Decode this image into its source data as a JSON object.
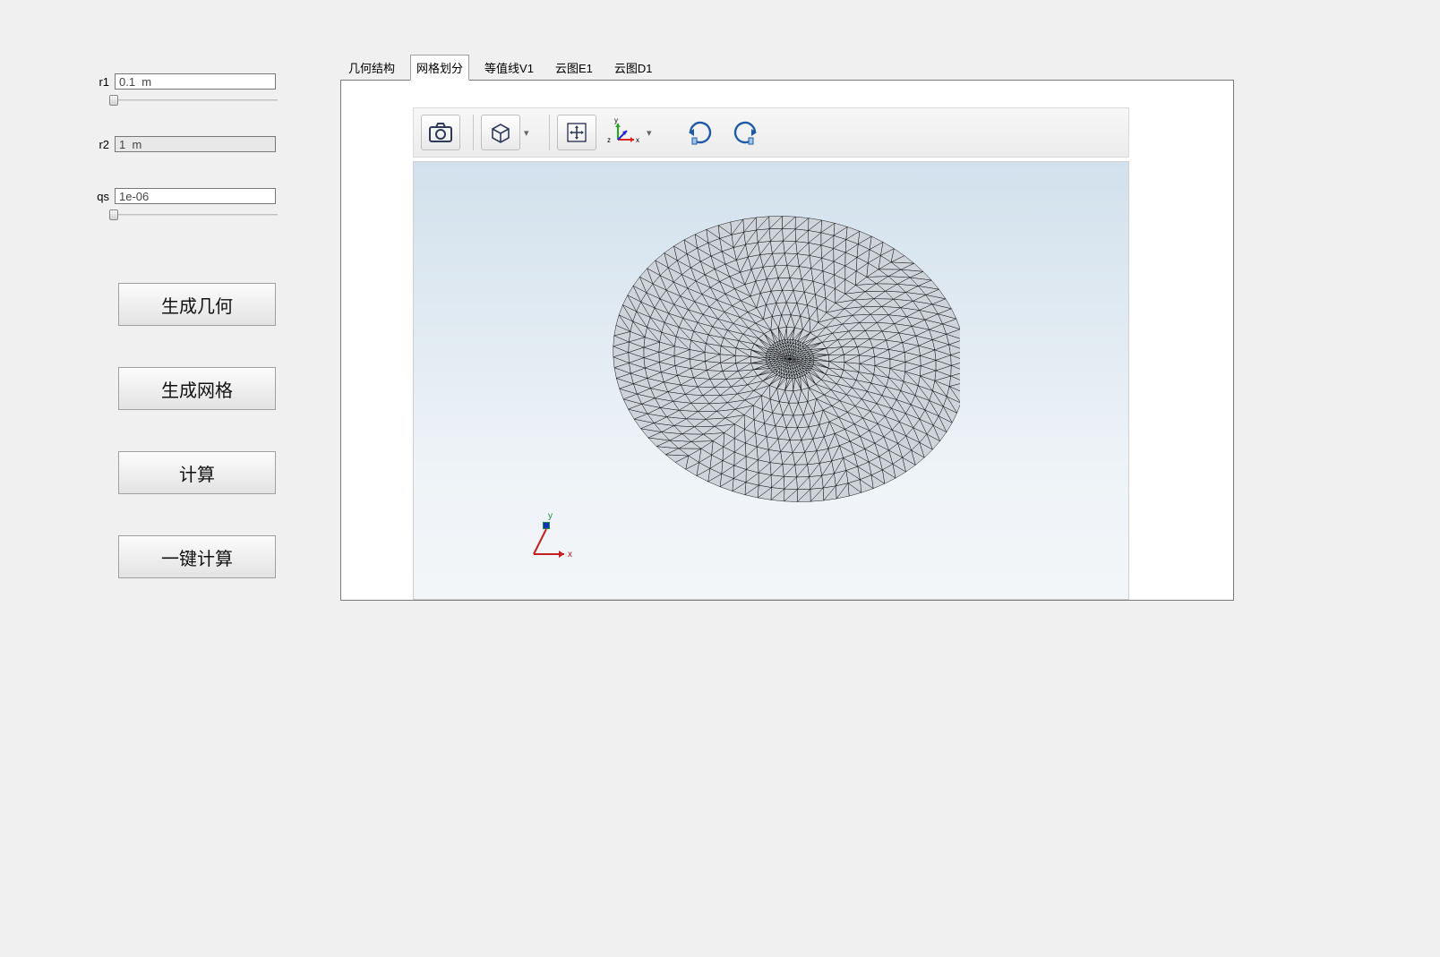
{
  "params": {
    "r1": {
      "label": "r1",
      "value": "0.1  m"
    },
    "r2": {
      "label": "r2",
      "value": "1  m"
    },
    "qs": {
      "label": "qs",
      "value": "1e-06"
    }
  },
  "buttons": {
    "gen_geometry": "生成几何",
    "gen_mesh": "生成网格",
    "compute": "计算",
    "one_click_compute": "一键计算"
  },
  "tabs": {
    "items": [
      {
        "label": "几何结构"
      },
      {
        "label": "网格划分"
      },
      {
        "label": "等值线V1"
      },
      {
        "label": "云图E1"
      },
      {
        "label": "云图D1"
      }
    ],
    "active_index": 1
  },
  "toolbar": {
    "icons": {
      "snapshot": "snapshot-icon",
      "view_cube": "view-cube-icon",
      "pan": "pan-icon",
      "axes": "axes-icon",
      "rotate_cw": "rotate-cw-icon",
      "rotate_ccw": "rotate-ccw-icon"
    },
    "axes_labels": {
      "x": "x",
      "y": "y",
      "z": "z"
    }
  },
  "canvas": {
    "axes_labels": {
      "x": "x",
      "y": "y"
    }
  }
}
